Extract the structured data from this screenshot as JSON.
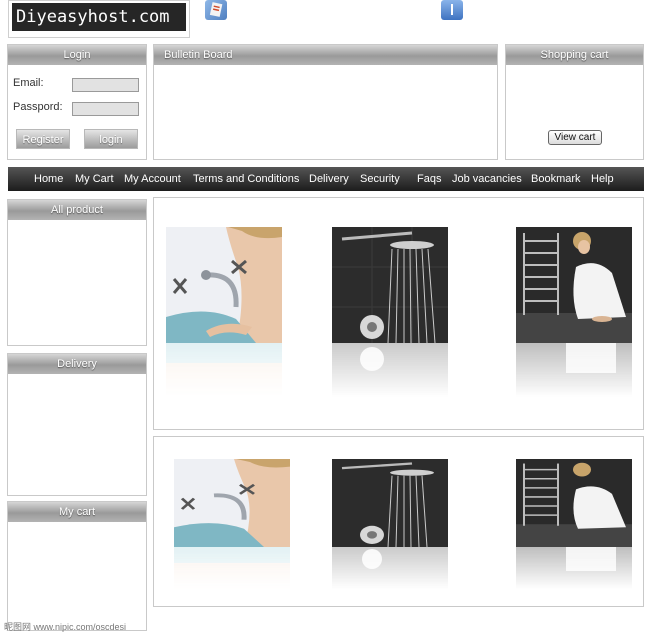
{
  "header": {
    "logo": "Diyeasyhost.com",
    "icons": [
      "note-icon",
      "info-icon"
    ]
  },
  "login": {
    "title": "Login",
    "email_label": "Email:",
    "password_label": "Passpord:",
    "email_value": "",
    "password_value": "",
    "register_label": "Register",
    "login_label": "login"
  },
  "bulletin": {
    "title": "Bulletin Board"
  },
  "cart": {
    "title": "Shopping cart",
    "view_label": "View cart"
  },
  "nav": {
    "items": [
      "Home",
      "My Cart",
      "My Account",
      "Terms and Conditions",
      "Delivery",
      "Security",
      "Faqs",
      "Job vacancies",
      "Bookmark",
      "Help"
    ]
  },
  "sidebar": {
    "all_product": "All product",
    "delivery": "Delivery",
    "my_cart": "My cart"
  },
  "products": {
    "row1": [
      "faucet-photo",
      "shower-photo",
      "towel-rail-photo"
    ],
    "row2": [
      "faucet-photo",
      "shower-photo",
      "towel-rail-photo"
    ]
  },
  "footer": {
    "watermark": "昵图网 www.nipic.com/oscdesi"
  },
  "colors": {
    "nav_bg": "#2b2b2b",
    "panel_header": "#a8a8a8",
    "logo_bg": "#262626"
  }
}
